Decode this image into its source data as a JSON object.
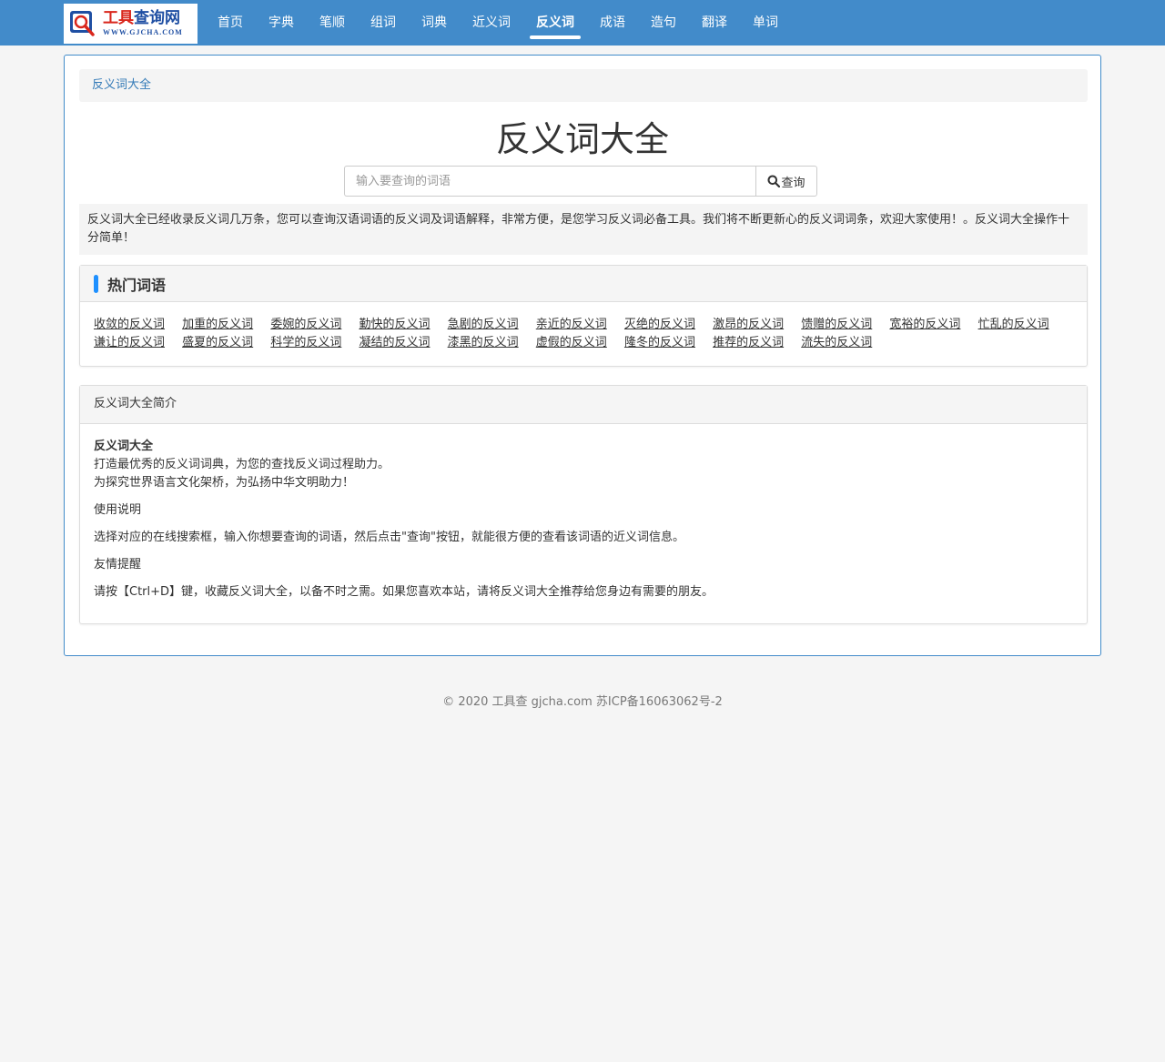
{
  "logo": {
    "title_red": "工具",
    "title_blue": "查询网",
    "url": "WWW.GJCHA.COM",
    "glyph": "查"
  },
  "nav": {
    "items": [
      {
        "label": "首页"
      },
      {
        "label": "字典"
      },
      {
        "label": "笔顺"
      },
      {
        "label": "组词"
      },
      {
        "label": "词典"
      },
      {
        "label": "近义词"
      },
      {
        "label": "反义词",
        "active": true
      },
      {
        "label": "成语"
      },
      {
        "label": "造句"
      },
      {
        "label": "翻译"
      },
      {
        "label": "单词"
      }
    ]
  },
  "breadcrumb": {
    "current": "反义词大全"
  },
  "main": {
    "title": "反义词大全",
    "search": {
      "placeholder": "输入要查询的词语",
      "button_label": "查询"
    },
    "intro": "反义词大全已经收录反义词几万条，您可以查询汉语词语的反义词及词语解释，非常方便，是您学习反义词必备工具。我们将不断更新心的反义词词条，欢迎大家使用！。反义词大全操作十分简单！"
  },
  "hot": {
    "title": "热门词语",
    "links": [
      "收敛的反义词",
      "加重的反义词",
      "委婉的反义词",
      "勤快的反义词",
      "急剧的反义词",
      "亲近的反义词",
      "灭绝的反义词",
      "激昂的反义词",
      "馈赠的反义词",
      "宽裕的反义词",
      "忙乱的反义词",
      "谦让的反义词",
      "盛夏的反义词",
      "科学的反义词",
      "凝结的反义词",
      "漆黑的反义词",
      "虚假的反义词",
      "隆冬的反义词",
      "推荐的反义词",
      "流失的反义词"
    ]
  },
  "about": {
    "heading": "反义词大全简介",
    "name": "反义词大全",
    "line1": "打造最优秀的反义词词典，为您的查找反义词过程助力。",
    "line2": "为探究世界语言文化架桥，为弘扬中华文明助力！",
    "usage_title": "使用说明",
    "usage_text": "选择对应的在线搜索框，输入你想要查询的词语，然后点击\"查询\"按钮，就能很方便的查看该词语的近义词信息。",
    "tip_title": "友情提醒",
    "tip_text": "请按【Ctrl+D】键，收藏反义词大全，以备不时之需。如果您喜欢本站，请将反义词大全推荐给您身边有需要的朋友。"
  },
  "footer": {
    "text": "© 2020 工具查 gjcha.com 苏ICP备16063062号-2"
  },
  "colors": {
    "navbar": "#428bca",
    "accent_bar": "#1e90ff",
    "link": "#337ab7"
  }
}
